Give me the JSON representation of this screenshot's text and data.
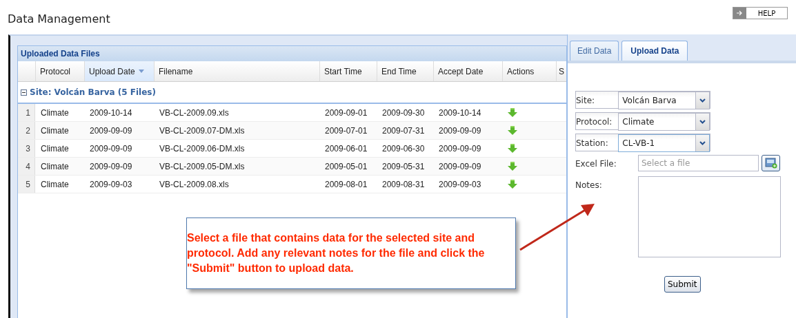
{
  "page": {
    "title": "Data Management",
    "help_button": "HELP"
  },
  "grid": {
    "title": "Uploaded Data Files",
    "columns": [
      {
        "label": "Protocol",
        "sorted": false
      },
      {
        "label": "Upload Date",
        "sorted": true
      },
      {
        "label": "Filename",
        "sorted": false
      },
      {
        "label": "Start Time",
        "sorted": false
      },
      {
        "label": "End Time",
        "sorted": false
      },
      {
        "label": "Accept Date",
        "sorted": false
      },
      {
        "label": "Actions",
        "sorted": false
      },
      {
        "label": "S",
        "sorted": false
      }
    ],
    "group": {
      "label": "Site: Volcán Barva (5 Files)",
      "expanded": true
    },
    "rows": [
      {
        "number": "1",
        "protocol": "Climate",
        "upload_date": "2009-10-14",
        "filename": "VB-CL-2009.09.xls",
        "start_time": "2009-09-01",
        "end_time": "2009-09-30",
        "accept_date": "2009-10-14"
      },
      {
        "number": "2",
        "protocol": "Climate",
        "upload_date": "2009-09-09",
        "filename": "VB-CL-2009.07-DM.xls",
        "start_time": "2009-07-01",
        "end_time": "2009-07-31",
        "accept_date": "2009-09-09"
      },
      {
        "number": "3",
        "protocol": "Climate",
        "upload_date": "2009-09-09",
        "filename": "VB-CL-2009.06-DM.xls",
        "start_time": "2009-06-01",
        "end_time": "2009-06-30",
        "accept_date": "2009-09-09"
      },
      {
        "number": "4",
        "protocol": "Climate",
        "upload_date": "2009-09-09",
        "filename": "VB-CL-2009.05-DM.xls",
        "start_time": "2009-05-01",
        "end_time": "2009-05-31",
        "accept_date": "2009-09-09"
      },
      {
        "number": "5",
        "protocol": "Climate",
        "upload_date": "2009-09-03",
        "filename": "VB-CL-2009.08.xls",
        "start_time": "2009-08-01",
        "end_time": "2009-08-31",
        "accept_date": "2009-09-03"
      }
    ]
  },
  "form": {
    "tabs": [
      {
        "label": "Edit Data",
        "selected": false
      },
      {
        "label": "Upload Data",
        "selected": true
      }
    ],
    "fields": [
      {
        "kind": "combo",
        "label": "Site:",
        "value": "Volcán Barva",
        "focused": false
      },
      {
        "kind": "combo",
        "label": "Protocol:",
        "value": "Climate",
        "focused": false
      },
      {
        "kind": "combo",
        "label": "Station:",
        "value": "CL-VB-1",
        "focused": true
      },
      {
        "kind": "file",
        "label": "Excel File:",
        "placeholder": "Select a file"
      },
      {
        "kind": "textarea",
        "label": "Notes:"
      }
    ],
    "submit": "Submit"
  },
  "callout": {
    "text": "Select a file that contains data for the selected site and protocol. Add any relevant notes for the file and click the \"Submit\" button to upload data."
  }
}
